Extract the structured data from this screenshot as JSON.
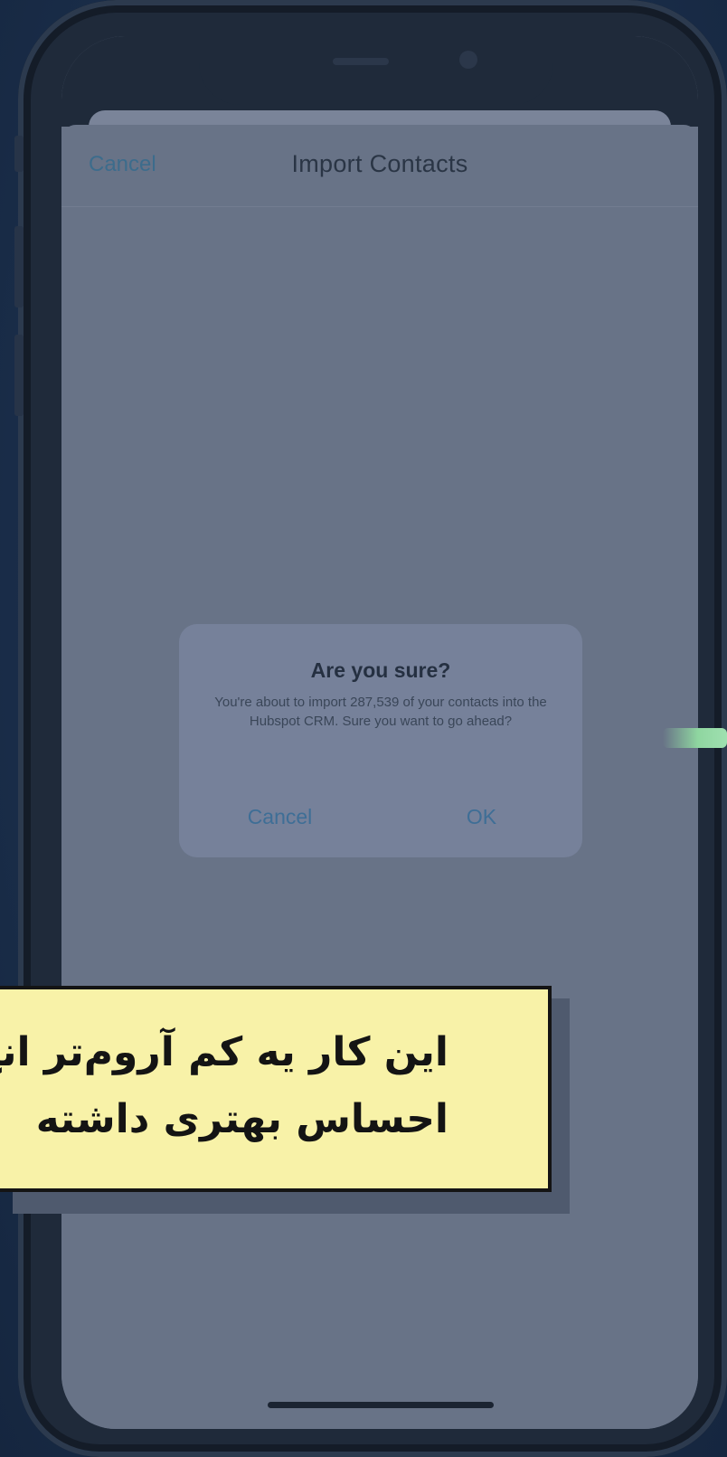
{
  "navigation": {
    "cancel_label": "Cancel",
    "title": "Import Contacts"
  },
  "alert": {
    "title": "Are you sure?",
    "message": "You're about to import 287,539 of your contacts into the Hubspot CRM. Sure you want to go ahead?",
    "cancel_label": "Cancel",
    "ok_label": "OK"
  },
  "caption": {
    "line1": "این کار یه کم آروم‌تر انج",
    "line2": "احساس بهتری داشته"
  },
  "colors": {
    "background": "#1b2f4c",
    "screen": "#687387",
    "caption_background": "#f8f2a8",
    "accent_blue": "#3e6e96"
  }
}
